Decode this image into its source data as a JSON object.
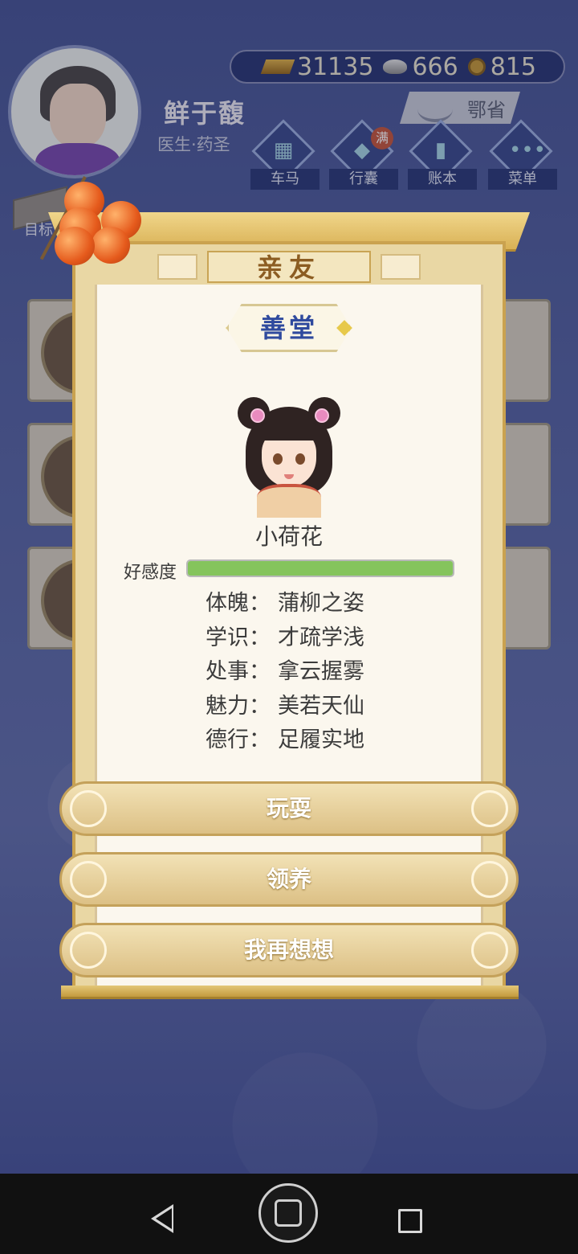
{
  "player": {
    "name": "鲜于馥",
    "title": "医生·药圣"
  },
  "currency": {
    "gold": "31135",
    "silver": "666",
    "copper": "815"
  },
  "region": {
    "label": "鄂省"
  },
  "nav": [
    {
      "label": "车马",
      "icon": "carriage-icon"
    },
    {
      "label": "行囊",
      "icon": "bag-icon",
      "badge": "满"
    },
    {
      "label": "账本",
      "icon": "ledger-icon"
    },
    {
      "label": "菜单",
      "icon": "menu-dots-icon"
    }
  ],
  "goal_button": {
    "label": "目标"
  },
  "dialog": {
    "title": "亲友",
    "hall": "善堂",
    "npc_name": "小荷花",
    "favor_label": "好感度",
    "favor_level": 1.0,
    "stats": [
      {
        "key": "体魄：",
        "value": "蒲柳之姿"
      },
      {
        "key": "学识：",
        "value": "才疏学浅"
      },
      {
        "key": "处事：",
        "value": "拿云握雾"
      },
      {
        "key": "魅力：",
        "value": "美若天仙"
      },
      {
        "key": "德行：",
        "value": "足履实地"
      }
    ],
    "buttons": {
      "play": "玩耍",
      "adopt": "领养",
      "think": "我再想想"
    }
  },
  "colors": {
    "accent_gold": "#caa24f",
    "favor_bar": "#85c45c",
    "hall_text": "#2f4a9e",
    "background": "#4a5796"
  }
}
